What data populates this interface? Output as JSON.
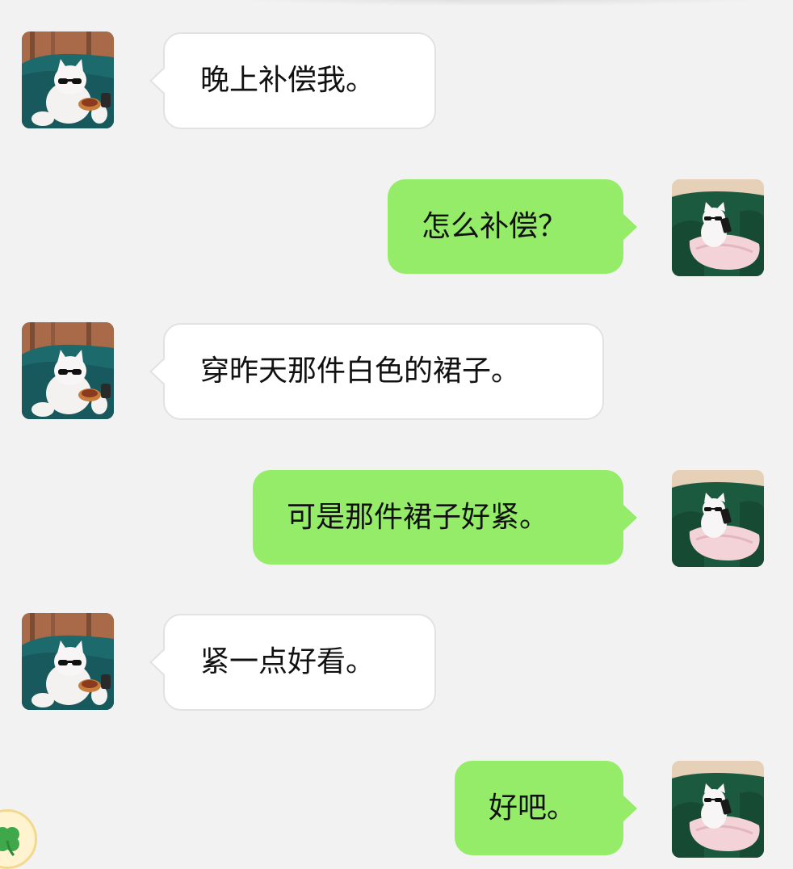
{
  "messages": [
    {
      "direction": "incoming",
      "text": "晚上补偿我。"
    },
    {
      "direction": "outgoing",
      "text": "怎么补偿？"
    },
    {
      "direction": "incoming",
      "text": "穿昨天那件白色的裙子。"
    },
    {
      "direction": "outgoing",
      "text": "可是那件裙子好紧。"
    },
    {
      "direction": "incoming",
      "text": "紧一点好看。"
    },
    {
      "direction": "outgoing",
      "text": "好吧。"
    }
  ],
  "colors": {
    "background": "#f2f2f2",
    "incoming_bubble": "#ffffff",
    "outgoing_bubble": "#95ec69"
  },
  "icons": {
    "incoming_avatar": "cat-with-sunglasses-avatar",
    "outgoing_avatar": "cat-with-phone-avatar",
    "floating_widget": "clover-icon"
  }
}
